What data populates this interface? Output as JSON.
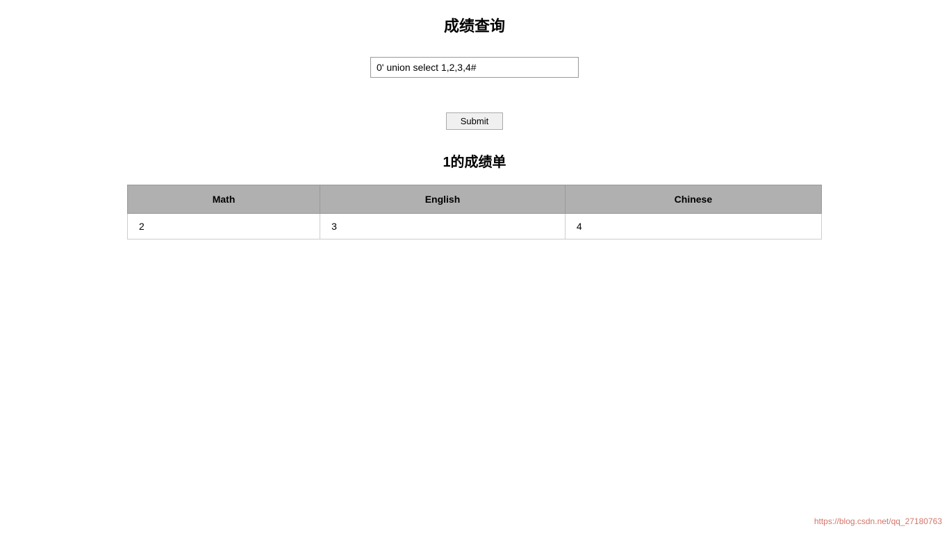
{
  "page": {
    "title": "成绩查询",
    "result_title": "1的成绩单"
  },
  "form": {
    "input_value": "0' union select 1,2,3,4#",
    "submit_label": "Submit"
  },
  "table": {
    "headers": [
      "Math",
      "English",
      "Chinese"
    ],
    "rows": [
      [
        "2",
        "3",
        "4"
      ]
    ]
  },
  "watermark": {
    "text": "https://blog.csdn.net/qq_27180763"
  }
}
